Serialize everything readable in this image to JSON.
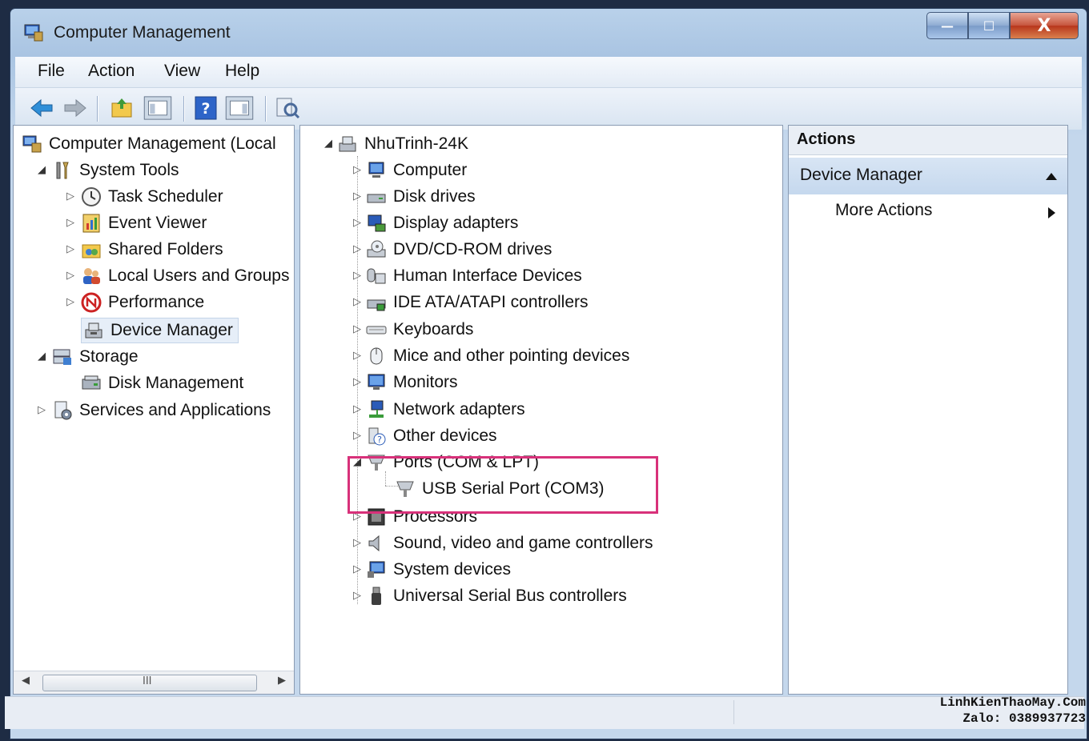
{
  "window": {
    "title": "Computer Management",
    "caption_buttons": {
      "minimize": "—",
      "maximize": "☐",
      "close": "X"
    }
  },
  "menu": [
    "File",
    "Action",
    "View",
    "Help"
  ],
  "toolbar": {
    "icons": [
      "back-icon",
      "forward-icon",
      "up-folder-icon",
      "show-hide-console-tree-icon",
      "help-icon",
      "show-hide-action-pane-icon",
      "properties-icon"
    ]
  },
  "left_tree": {
    "root": "Computer Management (Local",
    "items": [
      {
        "label": "System Tools",
        "level": 1,
        "state": "expanded"
      },
      {
        "label": "Task Scheduler",
        "level": 2,
        "state": "collapsed"
      },
      {
        "label": "Event Viewer",
        "level": 2,
        "state": "collapsed"
      },
      {
        "label": "Shared Folders",
        "level": 2,
        "state": "collapsed"
      },
      {
        "label": "Local Users and Groups",
        "level": 2,
        "state": "collapsed"
      },
      {
        "label": "Performance",
        "level": 2,
        "state": "collapsed"
      },
      {
        "label": "Device Manager",
        "level": 2,
        "state": "leaf",
        "selected": true
      },
      {
        "label": "Storage",
        "level": 1,
        "state": "expanded"
      },
      {
        "label": "Disk Management",
        "level": 2,
        "state": "leaf"
      },
      {
        "label": "Services and Applications",
        "level": 1,
        "state": "collapsed"
      }
    ],
    "scroll_marker": "III"
  },
  "device_tree": {
    "root": "NhuTrinh-24K",
    "categories": [
      {
        "label": "Computer",
        "icon": "computer-icon"
      },
      {
        "label": "Disk drives",
        "icon": "disk-drive-icon"
      },
      {
        "label": "Display adapters",
        "icon": "display-adapter-icon"
      },
      {
        "label": "DVD/CD-ROM drives",
        "icon": "dvd-drive-icon"
      },
      {
        "label": "Human Interface Devices",
        "icon": "hid-icon"
      },
      {
        "label": "IDE ATA/ATAPI controllers",
        "icon": "ide-controller-icon"
      },
      {
        "label": "Keyboards",
        "icon": "keyboard-icon"
      },
      {
        "label": "Mice and other pointing devices",
        "icon": "mouse-icon"
      },
      {
        "label": "Monitors",
        "icon": "monitor-icon"
      },
      {
        "label": "Network adapters",
        "icon": "network-adapter-icon"
      },
      {
        "label": "Other devices",
        "icon": "unknown-device-icon"
      },
      {
        "label": "Ports (COM & LPT)",
        "icon": "port-icon",
        "expanded": true
      },
      {
        "label": "USB Serial Port (COM3)",
        "icon": "port-icon",
        "child": true
      },
      {
        "label": "Processors",
        "icon": "processor-icon"
      },
      {
        "label": "Sound, video and game controllers",
        "icon": "speaker-icon"
      },
      {
        "label": "System devices",
        "icon": "system-device-icon"
      },
      {
        "label": "Universal Serial Bus controllers",
        "icon": "usb-icon"
      }
    ]
  },
  "actions": {
    "header": "Actions",
    "section": "Device Manager",
    "more": "More Actions"
  },
  "watermark": {
    "line1": "LinhKienThaoMay.Com",
    "line2": "Zalo: 0389937723"
  },
  "colors": {
    "highlight": "#d8317a",
    "selection": "#e6eef8"
  }
}
